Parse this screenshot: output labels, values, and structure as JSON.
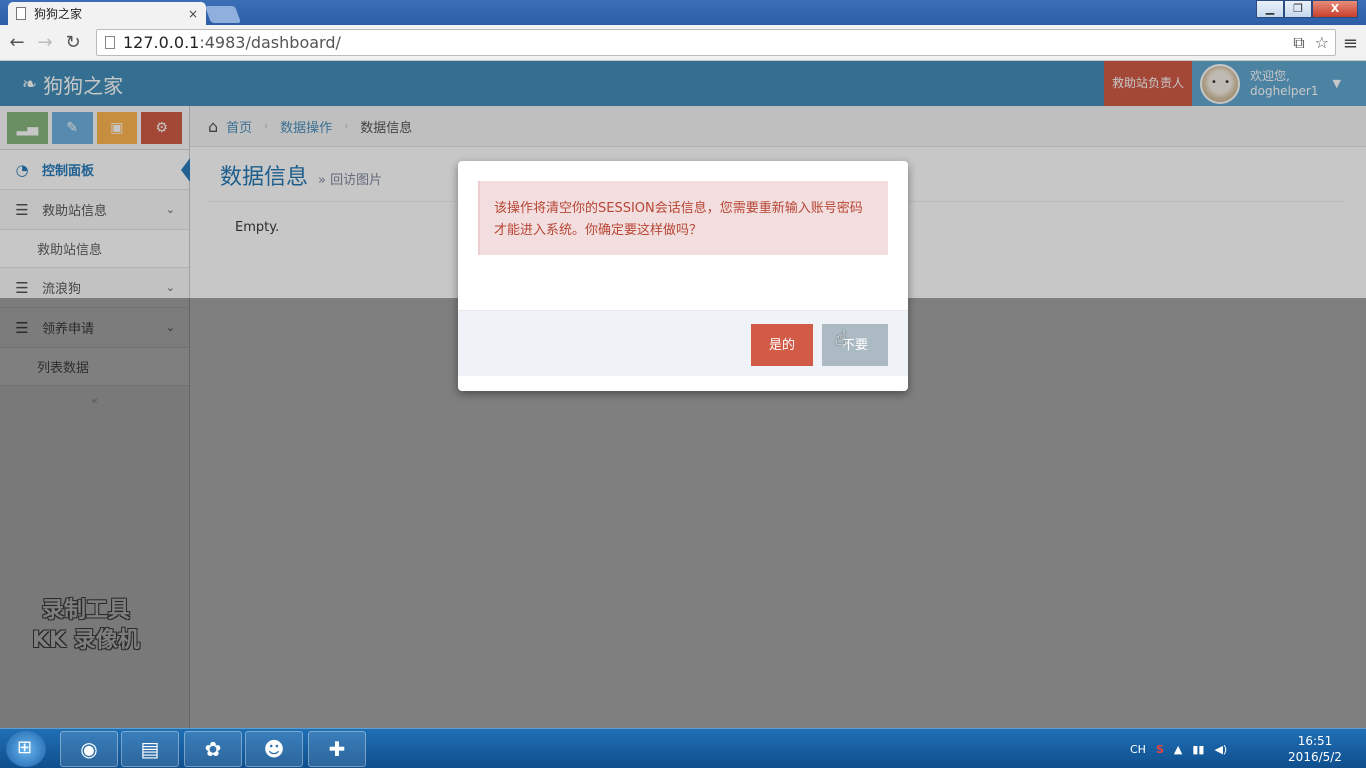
{
  "browser": {
    "tab_title": "狗狗之家",
    "tab_close": "×",
    "url_host": "127.0.0.1",
    "url_rest": ":4983/dashboard/",
    "back_icon": "arrow-left",
    "forward_icon": "arrow-right",
    "reload_icon": "reload",
    "win_min": "▁",
    "win_max": "❐",
    "win_close": "X"
  },
  "header": {
    "brand": "狗狗之家",
    "role_button": "救助站负责人",
    "welcome": "欢迎您,",
    "username": "doghelper1"
  },
  "sidebar": {
    "items": [
      {
        "label": "控制面板",
        "icon": "dashboard-icon"
      },
      {
        "label": "救助站信息",
        "icon": "list-icon"
      },
      {
        "label": "流浪狗",
        "icon": "list-icon"
      },
      {
        "label": "领养申请",
        "icon": "list-icon"
      }
    ],
    "sub_station": "救助站信息",
    "sub_list": "列表数据",
    "collapse": "«"
  },
  "breadcrumb": {
    "home": "首页",
    "section": "数据操作",
    "current": "数据信息"
  },
  "page": {
    "title": "数据信息",
    "subtitle_sep": "»",
    "subtitle": "回访图片",
    "empty": "Empty."
  },
  "modal": {
    "message": "该操作将清空你的SESSION会话信息，您需要重新输入账号密码才能进入系统。你确定要这样做吗？",
    "confirm": "是的",
    "cancel": "不要"
  },
  "watermark": {
    "line1": "录制工具",
    "line2": "KK 录像机"
  },
  "taskbar": {
    "lang": "CH",
    "time": "16:51",
    "date": "2016/5/2"
  },
  "colors": {
    "header": "#438eb9",
    "danger": "#d15b47",
    "cancel": "#abbac3"
  }
}
